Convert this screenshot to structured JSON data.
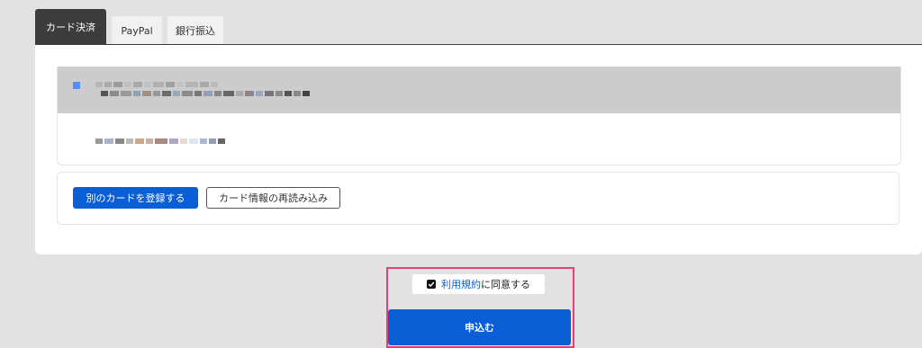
{
  "tabs": [
    {
      "label": "カード決済",
      "active": true
    },
    {
      "label": "PayPal",
      "active": false
    },
    {
      "label": "銀行振込",
      "active": false
    }
  ],
  "cards": {
    "selected_card_label": "",
    "other_card_label": ""
  },
  "actions": {
    "register_card_label": "別のカードを登録する",
    "reload_card_label": "カード情報の再読み込み"
  },
  "agreement": {
    "terms_link": "利用規約",
    "suffix": "に同意する",
    "checked": true
  },
  "submit_label": "申込む",
  "colors": {
    "primary": "#0a5fd6",
    "highlight_border": "#ee3b7a",
    "active_tab": "#3c3c3c"
  }
}
